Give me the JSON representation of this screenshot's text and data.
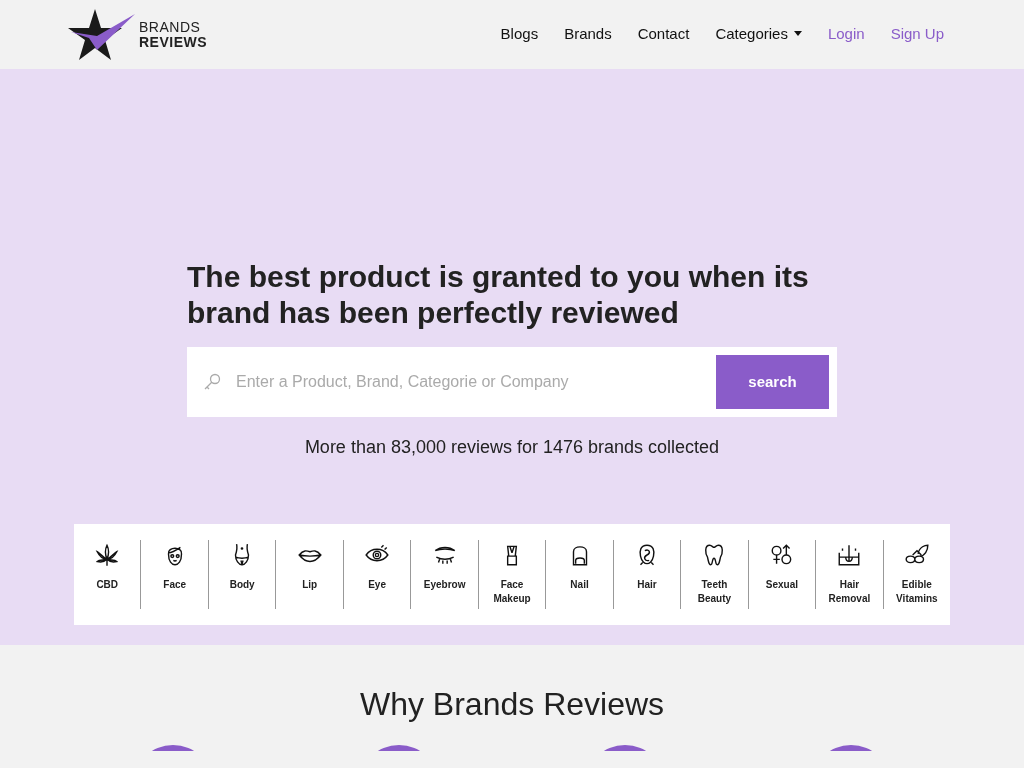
{
  "logo": {
    "lines": [
      "BRANDS",
      "REVIEWS"
    ]
  },
  "nav": [
    {
      "label": "Blogs",
      "kind": "link"
    },
    {
      "label": "Brands",
      "kind": "link"
    },
    {
      "label": "Contact",
      "kind": "link"
    },
    {
      "label": "Categories",
      "kind": "dropdown"
    },
    {
      "label": "Login",
      "kind": "auth"
    },
    {
      "label": "Sign Up",
      "kind": "auth"
    }
  ],
  "hero": {
    "headline": "The best product is granted to you when its brand has been perfectly reviewed",
    "search": {
      "placeholder": "Enter a Product, Brand, Categorie or Company",
      "button": "search"
    },
    "subtitle": "More than 83,000 reviews for 1476 brands collected"
  },
  "categories": [
    {
      "label": "CBD"
    },
    {
      "label": "Face"
    },
    {
      "label": "Body"
    },
    {
      "label": "Lip"
    },
    {
      "label": "Eye"
    },
    {
      "label": "Eyebrow"
    },
    {
      "label": "Face Makeup"
    },
    {
      "label": "Nail"
    },
    {
      "label": "Hair"
    },
    {
      "label": "Teeth Beauty"
    },
    {
      "label": "Sexual"
    },
    {
      "label": "Hair Removal"
    },
    {
      "label": "Edible Vitamins"
    }
  ],
  "why": {
    "title": "Why Brands Reviews",
    "features": [
      {
        "kind": "circle"
      },
      {
        "kind": "circle"
      },
      {
        "kind": "circle"
      },
      {
        "kind": "circle"
      }
    ]
  }
}
